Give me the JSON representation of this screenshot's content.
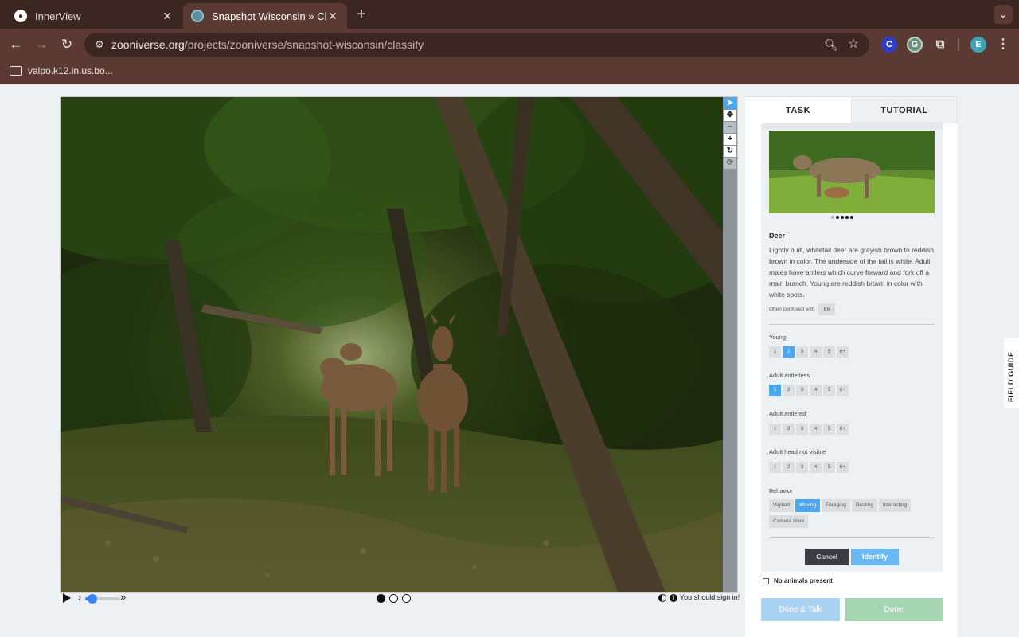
{
  "browser": {
    "tabs": [
      {
        "title": "InnerView",
        "active": false
      },
      {
        "title": "Snapshot Wisconsin » Classi",
        "active": true
      }
    ],
    "url_host": "zooniverse.org",
    "url_path": "/projects/zooniverse/snapshot-wisconsin/classify",
    "bookmark": "valpo.k12.in.us.bo...",
    "profile_initial": "E",
    "ext_c": "C",
    "ext_g": "G"
  },
  "viewer": {
    "frames": 3,
    "current_frame": 1,
    "slider_level": 0.2,
    "sign_in_note": "You should sign in!"
  },
  "panel": {
    "tab_task": "TASK",
    "tab_tutorial": "TUTORIAL",
    "species": {
      "name": "Deer",
      "description": "Lightly built, whitetail deer are grayish brown to reddish brown in color. The underside of the tail is white. Adult males have antlers which curve forward and fork off a main branch. Young are reddish brown in color with white spots.",
      "confused_label": "Often confused with",
      "confused_with": "Elk",
      "image_count": 5,
      "image_current": 2
    },
    "questions": [
      {
        "label": "Young",
        "options": [
          "1",
          "2",
          "3",
          "4",
          "5",
          "6+"
        ],
        "selected": "2"
      },
      {
        "label": "Adult antlerless",
        "options": [
          "1",
          "2",
          "3",
          "4",
          "5",
          "6+"
        ],
        "selected": "1"
      },
      {
        "label": "Adult antlered",
        "options": [
          "1",
          "2",
          "3",
          "4",
          "5",
          "6+"
        ],
        "selected": null
      },
      {
        "label": "Adult head not visible",
        "options": [
          "1",
          "2",
          "3",
          "4",
          "5",
          "6+"
        ],
        "selected": null
      }
    ],
    "behavior": {
      "label": "Behavior",
      "options": [
        "Vigilant",
        "Moving",
        "Foraging",
        "Resting",
        "Interacting",
        "Camera stare"
      ],
      "selected": "Moving"
    },
    "cancel_label": "Cancel",
    "identify_label": "Identify",
    "no_animals_label": "No animals present",
    "done_talk_label": "Done & Talk",
    "done_label": "Done",
    "field_guide_label": "FIELD GUIDE"
  },
  "colors": {
    "accent": "#4aa7f2",
    "browser_frame": "#3b2622",
    "done_green": "#a6d6b1",
    "done_talk_blue": "#a9d2f3"
  }
}
